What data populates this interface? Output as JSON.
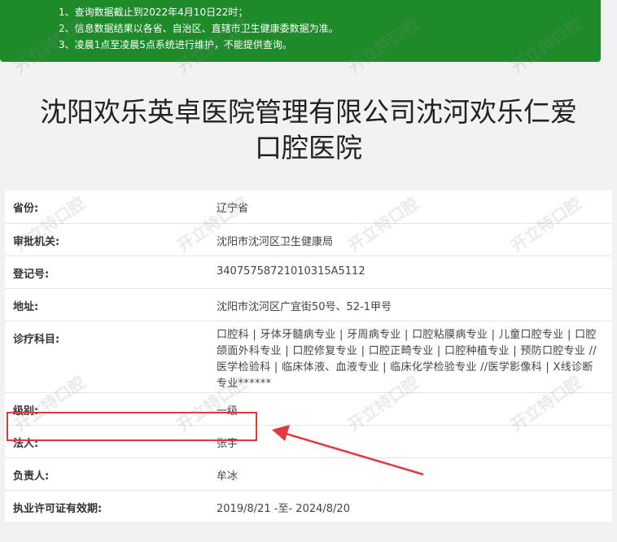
{
  "notice": {
    "lines": [
      "1、查询数据截止到2022年4月10日22时；",
      "2、信息数据结果以各省、自治区、直辖市卫生健康委数据为准。",
      "3、凌晨1点至凌晨5点系统进行维护，不能提供查询。"
    ]
  },
  "title": {
    "line1": "沈阳欢乐英卓医院管理有限公司沈河欢乐仁爱",
    "line2": "口腔医院"
  },
  "table": {
    "rows": [
      {
        "label": "省份:",
        "value": "辽宁省"
      },
      {
        "label": "审批机关:",
        "value": "沈阳市沈河区卫生健康局"
      },
      {
        "label": "登记号:",
        "value": "34075758721010315A5112"
      },
      {
        "label": "地址:",
        "value": "沈阳市沈河区广宜街50号、52-1甲号"
      },
      {
        "label": "诊疗科目:",
        "value": "口腔科 | 牙体牙髓病专业 | 牙周病专业 | 口腔粘膜病专业 | 儿童口腔专业 | 口腔颌面外科专业 | 口腔修复专业 | 口腔正畸专业 | 口腔种植专业 | 预防口腔专业 //医学检验科 | 临床体液、血液专业 | 临床化学检验专业 //医学影像科 | X线诊断专业******"
      },
      {
        "label": "级别:",
        "value": "一级"
      },
      {
        "label": "法人:",
        "value": "张宇"
      },
      {
        "label": "负责人:",
        "value": "牟冰"
      },
      {
        "label": "执业许可证有效期:",
        "value": "2019/8/21 -至- 2024/8/20"
      }
    ]
  },
  "watermark": {
    "text": "开立特口腔"
  },
  "colors": {
    "notice_bg": "#1e8a2a",
    "highlight": "#e0393e"
  }
}
